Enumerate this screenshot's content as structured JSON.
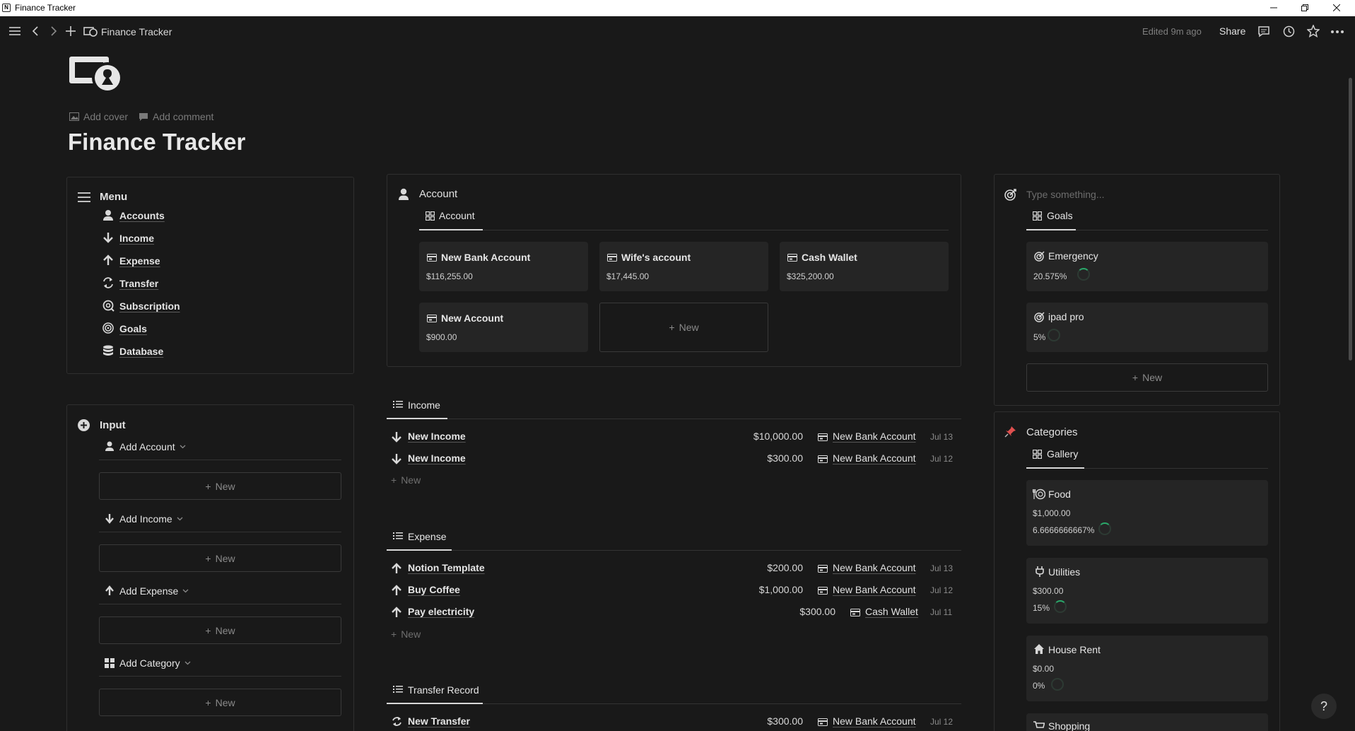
{
  "window": {
    "title": "Finance Tracker"
  },
  "topbar": {
    "breadcrumb": "Finance Tracker",
    "edited": "Edited 9m ago",
    "share": "Share"
  },
  "page": {
    "title": "Finance Tracker",
    "add_cover": "Add cover",
    "add_comment": "Add comment"
  },
  "menu": {
    "heading": "Menu",
    "items": [
      {
        "label": "Accounts",
        "icon": "person-icon"
      },
      {
        "label": "Income",
        "icon": "arrow-down-icon"
      },
      {
        "label": "Expense",
        "icon": "arrow-up-icon"
      },
      {
        "label": "Transfer",
        "icon": "transfer-icon"
      },
      {
        "label": "Subscription",
        "icon": "subscription-icon"
      },
      {
        "label": "Goals",
        "icon": "target-icon"
      },
      {
        "label": "Database",
        "icon": "database-icon"
      }
    ]
  },
  "input": {
    "heading": "Input",
    "sections": [
      {
        "label": "Add Account",
        "new": "New"
      },
      {
        "label": "Add Income",
        "new": "New"
      },
      {
        "label": "Add Expense",
        "new": "New"
      },
      {
        "label": "Add Category",
        "new": "New"
      }
    ]
  },
  "account": {
    "heading": "Account",
    "tab": "Account",
    "cards": [
      {
        "name": "New Bank Account",
        "value": "$116,255.00"
      },
      {
        "name": "Wife's account",
        "value": "$17,445.00"
      },
      {
        "name": "Cash Wallet",
        "value": "$325,200.00"
      },
      {
        "name": "New Account",
        "value": "$900.00"
      }
    ],
    "new": "New"
  },
  "income": {
    "tab": "Income",
    "rows": [
      {
        "title": "New Income",
        "amount": "$10,000.00",
        "account": "New Bank Account",
        "date": "Jul 13"
      },
      {
        "title": "New Income",
        "amount": "$300.00",
        "account": "New Bank Account",
        "date": "Jul 12"
      }
    ],
    "new": "New"
  },
  "expense": {
    "tab": "Expense",
    "rows": [
      {
        "title": "Notion Template",
        "amount": "$200.00",
        "account": "New Bank Account",
        "date": "Jul 13"
      },
      {
        "title": "Buy Coffee",
        "amount": "$1,000.00",
        "account": "New Bank Account",
        "date": "Jul 12"
      },
      {
        "title": "Pay electricity",
        "amount": "$300.00",
        "account": "Cash Wallet",
        "date": "Jul 11"
      }
    ],
    "new": "New"
  },
  "transfer": {
    "tab": "Transfer Record",
    "rows": [
      {
        "title": "New Transfer",
        "amount": "$300.00",
        "account": "New Bank Account",
        "date": "Jul 12"
      }
    ]
  },
  "goals": {
    "placeholder": "Type something...",
    "tab": "Goals",
    "cards": [
      {
        "name": "Emergency",
        "percent": "20.575%",
        "progress": 0.20575
      },
      {
        "name": "ipad pro",
        "percent": "5%",
        "progress": 0.05
      }
    ],
    "new": "New"
  },
  "categories": {
    "heading": "Categories",
    "tab": "Gallery",
    "cards": [
      {
        "name": "Food",
        "amount": "$1,000.00",
        "percent": "6.6666666667%",
        "progress": 0.0667,
        "icon": "food-icon"
      },
      {
        "name": "Utilities",
        "amount": "$300.00",
        "percent": "15%",
        "progress": 0.15,
        "icon": "plug-icon"
      },
      {
        "name": "House Rent",
        "amount": "$0.00",
        "percent": "0%",
        "progress": 0,
        "icon": "house-icon"
      },
      {
        "name": "Shopping",
        "icon": "cart-icon"
      }
    ]
  },
  "help": "?"
}
